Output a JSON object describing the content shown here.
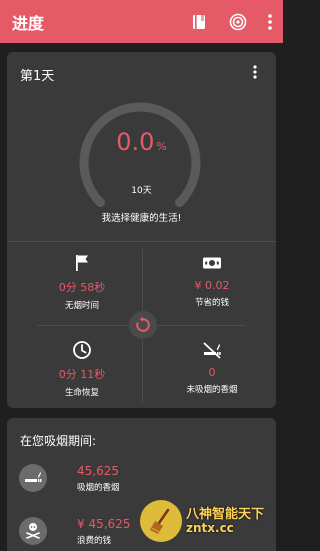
{
  "colors": {
    "accent": "#e45a67",
    "card_bg": "#3a3a3a",
    "page_bg": "#1f1f1f",
    "gauge_track": "#5a5a5a",
    "text_primary": "#ffffff"
  },
  "topbar": {
    "title": "进度",
    "icons": [
      "journal-icon",
      "target-icon",
      "more-vert-icon"
    ]
  },
  "progress_card": {
    "day_label": "第1天",
    "gauge": {
      "value": "0.0",
      "unit": "%",
      "progress_percent": 0.0,
      "target_label": "10天"
    },
    "motto": "我选择健康的生活!",
    "stats": [
      {
        "icon": "flag-icon",
        "value": "0分 58秒",
        "label": "无烟时间"
      },
      {
        "icon": "money-icon",
        "value": "¥ 0.02",
        "label": "节省的钱"
      },
      {
        "icon": "clock-icon",
        "value": "0分 11秒",
        "label": "生命恢复"
      },
      {
        "icon": "no-smoking-icon",
        "value": "0",
        "label": "未吸烟的香烟"
      }
    ],
    "reset_icon": "reset-icon"
  },
  "smoking_card": {
    "title": "在您吸烟期间:",
    "rows": [
      {
        "icon": "cigarette-icon",
        "value": "45,625",
        "label": "吸烟的香烟"
      },
      {
        "icon": "skull-money-icon",
        "value": "¥ 45,625",
        "label": "浪费的钱"
      }
    ]
  },
  "watermark": {
    "name": "八神智能天下",
    "url": "zntx.cc"
  }
}
